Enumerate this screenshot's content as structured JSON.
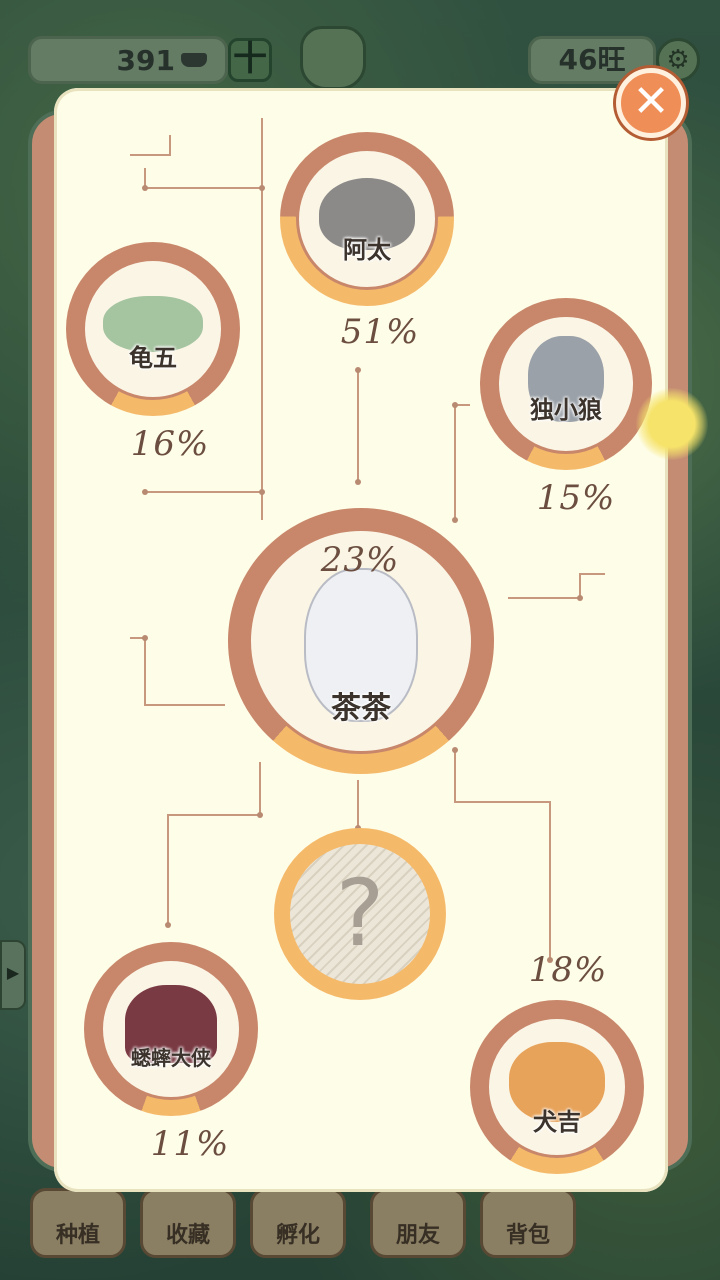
{
  "topbar": {
    "coins": "391",
    "plus_label": "十",
    "spirit": "46旺"
  },
  "panel": {
    "close_label": "✕",
    "question_mark": "?"
  },
  "characters": [
    {
      "id": "atai",
      "name": "阿太",
      "percent_label": "51%",
      "percent": 51
    },
    {
      "id": "guiwu",
      "name": "龟五",
      "percent_label": "16%",
      "percent": 16
    },
    {
      "id": "duxiaolang",
      "name": "独小狼",
      "percent_label": "15%",
      "percent": 15
    },
    {
      "id": "chacha",
      "name": "茶茶",
      "percent_label": "23%",
      "percent": 23
    },
    {
      "id": "xishuai",
      "name": "蟋蟀大侠",
      "percent_label": "11%",
      "percent": 11
    },
    {
      "id": "quanji",
      "name": "犬吉",
      "percent_label": "18%",
      "percent": 18
    }
  ],
  "bottom_nav": [
    {
      "label": "种植",
      "icon": "sprout-icon"
    },
    {
      "label": "收藏",
      "icon": "collection-icon"
    },
    {
      "label": "孵化",
      "icon": "egg-icon"
    },
    {
      "label": "朋友",
      "icon": "friends-icon"
    },
    {
      "label": "背包",
      "icon": "backpack-icon"
    }
  ],
  "colors": {
    "ring_outer": "#c8876b",
    "ring_progress": "#f5b96a",
    "panel_bg": "#fefde7",
    "close_btn": "#f08e58"
  }
}
